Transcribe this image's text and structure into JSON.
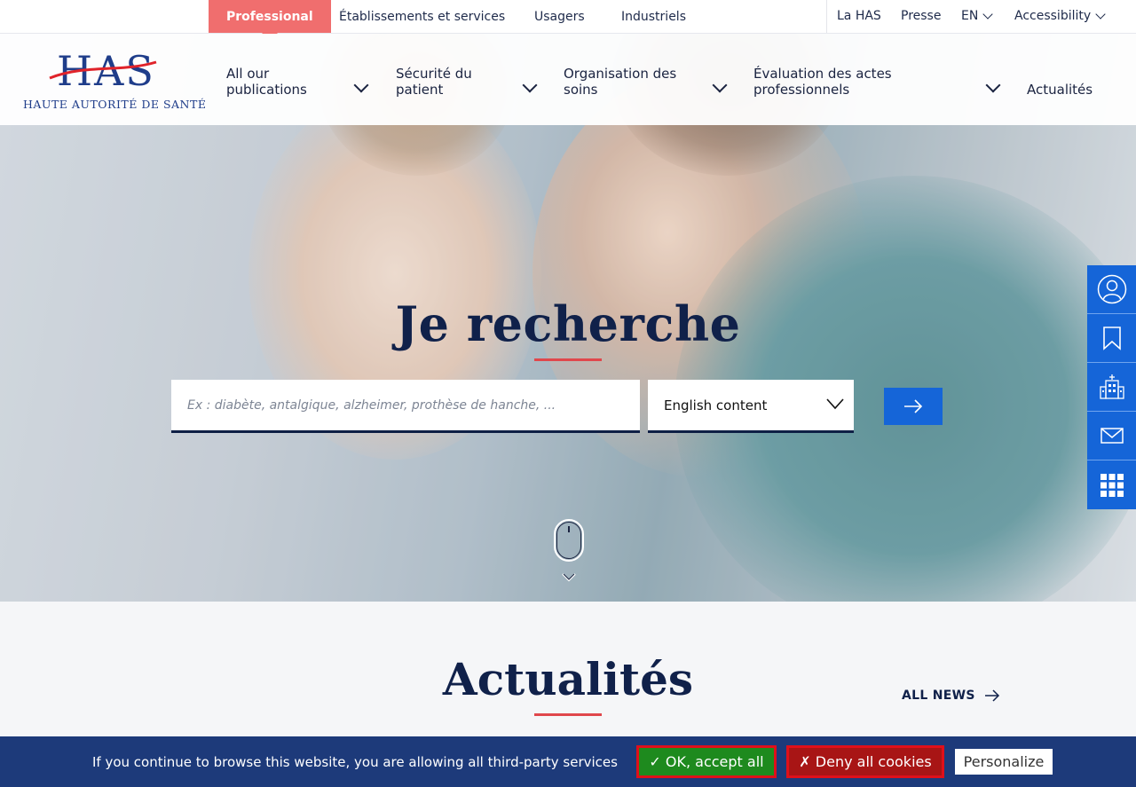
{
  "topbar": {
    "audience_tabs": [
      {
        "label": "Professional",
        "active": true
      },
      {
        "label": "Établissements et services",
        "active": false
      },
      {
        "label": "Usagers",
        "active": false
      },
      {
        "label": "Industriels",
        "active": false
      }
    ],
    "links": {
      "la_has": "La HAS",
      "presse": "Presse",
      "language": "EN",
      "accessibility": "Accessibility"
    }
  },
  "logo": {
    "letters": "HAS",
    "caption": "HAUTE AUTORITÉ DE SANTÉ"
  },
  "nav": {
    "items": [
      {
        "label": "All our publications",
        "has_dropdown": true
      },
      {
        "label": "Sécurité du patient",
        "has_dropdown": true
      },
      {
        "label": "Organisation des soins",
        "has_dropdown": true
      },
      {
        "label": "Évaluation des actes professionnels",
        "has_dropdown": true
      },
      {
        "label": "Actualités",
        "has_dropdown": false
      }
    ]
  },
  "hero": {
    "title": "Je recherche",
    "search": {
      "placeholder": "Ex : diabète, antalgique, alzheimer, prothèse de hanche, ...",
      "value": ""
    },
    "language_select": {
      "selected": "English content"
    },
    "search_button_icon": "arrow-right-icon",
    "scroll_icon": "mouse-scroll-icon"
  },
  "dock": {
    "items": [
      {
        "icon": "user-icon"
      },
      {
        "icon": "bookmark-icon"
      },
      {
        "icon": "hospital-icon"
      },
      {
        "icon": "mail-icon"
      },
      {
        "icon": "grid-icon"
      }
    ]
  },
  "news": {
    "title": "Actualités",
    "all_news": "ALL NEWS"
  },
  "cookie": {
    "text": "If you continue to browse this website, you are allowing all third-party services",
    "accept": "✓ OK, accept all",
    "deny": "✗ Deny all cookies",
    "personalize": "Personalize"
  },
  "colors": {
    "brand_navy": "#10214a",
    "accent_red": "#e0474c",
    "active_tab": "#f06e6e",
    "action_blue": "#1565d8",
    "cookie_bg": "#1d3a7a",
    "accept_green": "#1e8a1e",
    "deny_red": "#a81515"
  }
}
